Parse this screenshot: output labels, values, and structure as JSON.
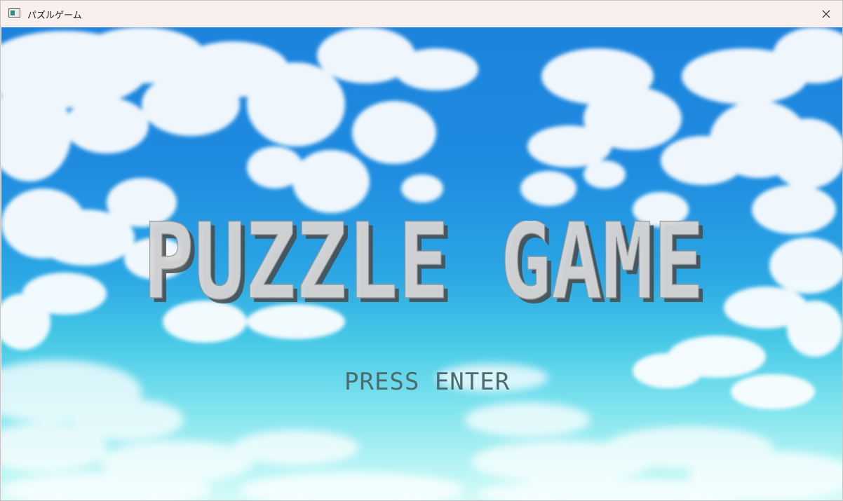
{
  "window": {
    "title": "パズルゲーム",
    "app_icon": "window-app-icon",
    "close_icon": "close-icon"
  },
  "game": {
    "title_logo": "PUZZLE GAME",
    "prompt": "PRESS ENTER",
    "colors": {
      "sky_top": "#1c83dc",
      "sky_horizon": "#d6fbf9",
      "logo_fill": "#d6d6d6",
      "logo_shadow": "#4a4a4a",
      "prompt_text": "#4d6b6e"
    }
  }
}
